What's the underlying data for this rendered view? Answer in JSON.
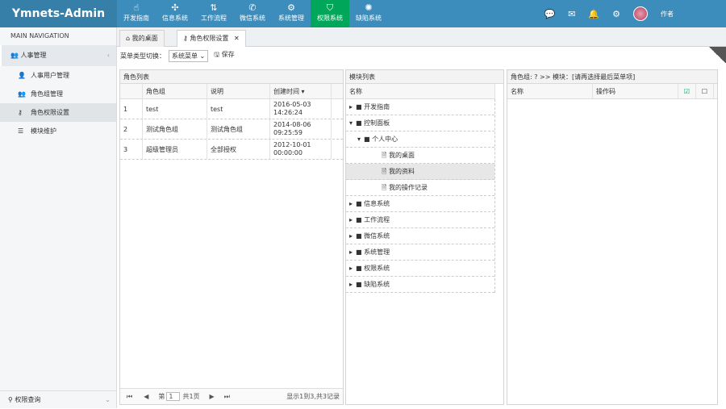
{
  "app": {
    "title": "Ymnets-Admin"
  },
  "topmenu": [
    {
      "label": "开发指南",
      "icon": "hand-pointer-icon"
    },
    {
      "label": "信息系统",
      "icon": "puzzle-icon"
    },
    {
      "label": "工作流程",
      "icon": "sort-icon"
    },
    {
      "label": "微信系统",
      "icon": "wechat-icon"
    },
    {
      "label": "系统管理",
      "icon": "cogs-icon"
    },
    {
      "label": "权限系统",
      "icon": "shield-icon"
    },
    {
      "label": "缺陷系统",
      "icon": "bug-icon"
    }
  ],
  "user": {
    "name": "作者"
  },
  "sidebar": {
    "header": "MAIN NAVIGATION",
    "group": "人事管理",
    "items": [
      {
        "label": "人事用户管理",
        "icon": "user-icon"
      },
      {
        "label": "角色组管理",
        "icon": "users-icon"
      },
      {
        "label": "角色权限设置",
        "icon": "key-icon"
      },
      {
        "label": "模块维护",
        "icon": "list-icon"
      }
    ],
    "footer": "权限查询"
  },
  "tabs": [
    {
      "label": "我的桌面"
    },
    {
      "label": "角色权限设置"
    }
  ],
  "toolbar": {
    "switch_label": "菜单类型切换：",
    "menu_type": "系统菜单",
    "save_label": "保存"
  },
  "roles": {
    "title": "角色列表",
    "columns": [
      "角色组",
      "说明",
      "创建时间"
    ],
    "rows": [
      {
        "no": "1",
        "name": "test",
        "desc": "test",
        "date": "2016-05-03",
        "time": "14:26:24"
      },
      {
        "no": "2",
        "name": "测试角色组",
        "desc": "测试角色组",
        "date": "2014-08-06",
        "time": "09:25:59"
      },
      {
        "no": "3",
        "name": "超级管理员",
        "desc": "全部授权",
        "date": "2012-10-01",
        "time": "00:00:00"
      }
    ],
    "pager": {
      "page_prefix": "第",
      "page": "1",
      "total_pages": "共1页",
      "summary": "显示1到3,共3记录"
    }
  },
  "modules": {
    "title": "模块列表",
    "column": "名称",
    "tree": [
      {
        "label": "开发指南",
        "level": 0,
        "type": "folder",
        "open": false
      },
      {
        "label": "控制面板",
        "level": 0,
        "type": "folder",
        "open": true
      },
      {
        "label": "个人中心",
        "level": 1,
        "type": "folder",
        "open": true
      },
      {
        "label": "我的桌面",
        "level": 2,
        "type": "file"
      },
      {
        "label": "我的资料",
        "level": 2,
        "type": "file",
        "selected": true
      },
      {
        "label": "我的操作记录",
        "level": 2,
        "type": "file"
      },
      {
        "label": "信息系统",
        "level": 0,
        "type": "folder",
        "open": false
      },
      {
        "label": "工作流程",
        "level": 0,
        "type": "folder",
        "open": false
      },
      {
        "label": "微信系统",
        "level": 0,
        "type": "folder",
        "open": false
      },
      {
        "label": "系统管理",
        "level": 0,
        "type": "folder",
        "open": false
      },
      {
        "label": "权限系统",
        "level": 0,
        "type": "folder",
        "open": false
      },
      {
        "label": "缺陷系统",
        "level": 0,
        "type": "folder",
        "open": false
      }
    ]
  },
  "perms": {
    "title": "角色组: ? >> 模块：[请再选择最后菜单项]",
    "columns": [
      "名称",
      "操作码"
    ]
  },
  "colors": {
    "topbar": "#3c8dbc",
    "brand": "#367fa9",
    "active": "#00a65a"
  }
}
